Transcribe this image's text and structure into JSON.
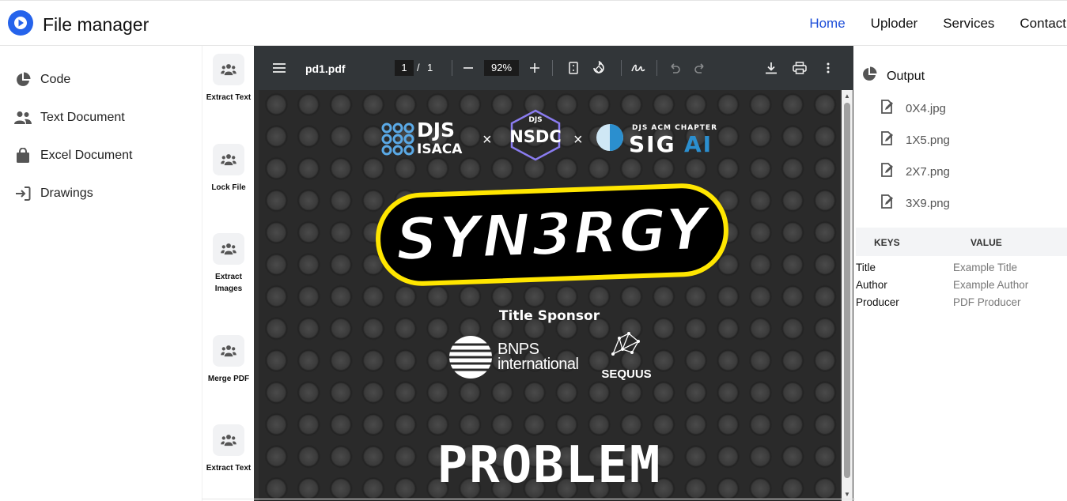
{
  "header": {
    "title": "File manager",
    "nav": [
      {
        "label": "Home",
        "active": true
      },
      {
        "label": "Uploder"
      },
      {
        "label": "Services"
      },
      {
        "label": "Contact"
      }
    ],
    "accent": "#1d4ed8"
  },
  "sidebar": {
    "items": [
      {
        "label": "Code",
        "icon": "pie-chart-icon"
      },
      {
        "label": "Text Document",
        "icon": "users-icon"
      },
      {
        "label": "Excel Document",
        "icon": "shopping-bag-icon"
      },
      {
        "label": "Drawings",
        "icon": "sign-in-icon"
      }
    ]
  },
  "tools": [
    {
      "label": "Extract Text",
      "icon": "users-icon"
    },
    {
      "label": "Lock File",
      "icon": "users-icon"
    },
    {
      "label": "Extract Images",
      "icon": "users-icon"
    },
    {
      "label": "Merge PDF",
      "icon": "users-icon"
    },
    {
      "label": "Extract Text",
      "icon": "users-icon"
    }
  ],
  "viewer": {
    "filename": "pd1.pdf",
    "page_current": "1",
    "page_separator": "/",
    "page_total": "1",
    "zoom": "92%",
    "page": {
      "brand1": "DJS ISACA",
      "brand2": "DJS NSDC",
      "brand3": "DJS ACM CHAPTER SIGAI",
      "cross": "×",
      "main_title": "SYN3RGY",
      "sponsor_label": "Title Sponsor",
      "sponsor1_line1": "BNPS",
      "sponsor1_line2": "international",
      "sponsor2": "SEQUUS",
      "heading": "PROBLEM"
    }
  },
  "output": {
    "title": "Output",
    "files": [
      "0X4.jpg",
      "1X5.png",
      "2X7.png",
      "3X9.png"
    ]
  },
  "metadata": {
    "headers": {
      "key": "KEYS",
      "value": "VALUE"
    },
    "rows": [
      {
        "key": "Title",
        "value": "Example Title"
      },
      {
        "key": "Author",
        "value": "Example Author"
      },
      {
        "key": "Producer",
        "value": "PDF Producer"
      }
    ]
  }
}
